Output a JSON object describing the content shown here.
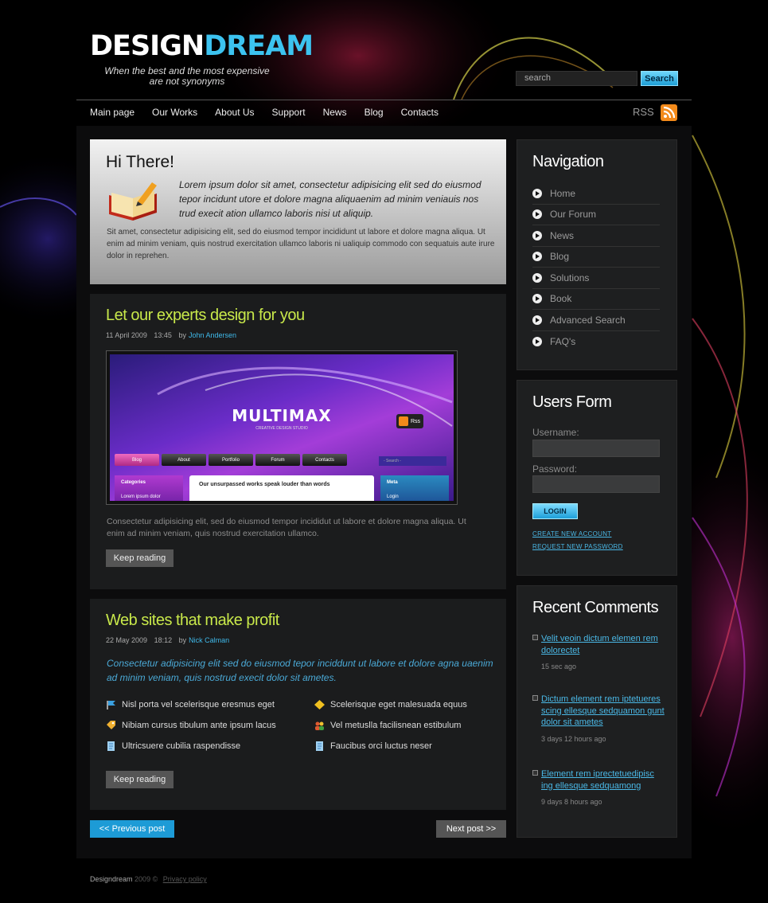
{
  "header": {
    "logo_part1": "DESIGN",
    "logo_part2": "DREAM",
    "tagline_line1": "When the best and the most expensive",
    "tagline_line2": "are not synonyms",
    "search_placeholder": "search",
    "search_button": "Search"
  },
  "topnav": {
    "items": [
      "Main page",
      "Our Works",
      "About Us",
      "Support",
      "News",
      "Blog",
      "Contacts"
    ],
    "rss_label": "RSS"
  },
  "welcome": {
    "title": "Hi There!",
    "lead": "Lorem ipsum dolor sit amet, consectetur adipisicing elit sed do eiusmod tepor incidunt utore et dolore magna aliquaenim ad minim veniauis nos trud execit ation ullamco laboris nisi ut aliquip.",
    "body": "Sit amet, consectetur adipisicing elit, sed do eiusmod tempor incididunt ut labore et dolore magna aliqua. Ut enim ad minim veniam, quis nostrud exercitation ullamco laboris ni ualiquip commodo con sequatuis aute irure dolor in reprehen."
  },
  "post1": {
    "title": "Let our experts design for you",
    "date": "11 April 2009",
    "time": "13:45",
    "by": "by",
    "author": "John Andersen",
    "thumb": {
      "title": "MULTIMAX",
      "subtitle": "CREATIVE DESIGN STUDIO",
      "rss": "Rss",
      "nav": [
        "Blog",
        "About",
        "Portfolio",
        "Forum",
        "Contacts"
      ],
      "search": "- Search -",
      "box1_title": "Categories",
      "box1_item": "Lorem ipsum dolor",
      "box2_text": "Our unsurpassed works speak louder than words",
      "box3_title": "Meta",
      "box3_item": "Login"
    },
    "excerpt": "Consectetur adipisicing elit, sed do eiusmod tempor incididut ut labore et dolore magna aliqua. Ut enim ad minim veniam, quis nostrud exercitation ullamco.",
    "button": "Keep reading"
  },
  "post2": {
    "title": "Web sites that make profit",
    "date": "22 May 2009",
    "time": "18:12",
    "by": "by",
    "author": "Nick Calman",
    "lead": "Consectetur adipisicing elit sed do eiusmod tepor inciddunt ut labore et dolore agna uaenim ad minim veniam, quis nostrud execit dolor sit ametes.",
    "features": [
      {
        "text": "Nisl porta vel scelerisque eresmus eget",
        "icon": "flag-icon"
      },
      {
        "text": "Scelerisque eget malesuada equus",
        "icon": "diamond-icon"
      },
      {
        "text": "Nibiam cursus tibulum ante ipsum lacus",
        "icon": "tag-icon"
      },
      {
        "text": "Vel metuslla facilisnean estibulum",
        "icon": "users-icon"
      },
      {
        "text": "Ultricsuere cubilia raspendisse",
        "icon": "document-icon"
      },
      {
        "text": "Faucibus orci luctus neser",
        "icon": "document-icon"
      }
    ],
    "button": "Keep reading"
  },
  "pager": {
    "prev": "<<  Previous post",
    "next": "Next post  >>"
  },
  "sidebar": {
    "navigation": {
      "title": "Navigation",
      "items": [
        "Home",
        "Our Forum",
        "News",
        "Blog",
        "Solutions",
        "Book",
        "Advanced Search",
        "FAQ's"
      ]
    },
    "users_form": {
      "title": "Users Form",
      "username_label": "Username:",
      "password_label": "Password:",
      "login_button": "LOGIN",
      "create_link": "CREATE NEW ACCOUNT",
      "request_link": "REQUEST NEW PASSWORD"
    },
    "recent_comments": {
      "title": "Recent Comments",
      "items": [
        {
          "text": "Velit veoin dictum elemen rem dolorectet",
          "time": "15 sec ago"
        },
        {
          "text": "Dictum element rem iptetueres scing ellesque sedquamon gunt dolor sit ametes",
          "time": "3 days 12 hours ago"
        },
        {
          "text": "Element rem iprectetuedipisc ing ellesque sedquamong",
          "time": "9 days 8 hours ago"
        }
      ]
    }
  },
  "footer": {
    "brand": "Designdream",
    "year": "2009 ©",
    "privacy": "Privacy policy"
  },
  "colors": {
    "accent": "#3cc3f0",
    "post_title": "#c8e84a",
    "link": "#4ab8e6",
    "rss": "#f38a1a"
  }
}
